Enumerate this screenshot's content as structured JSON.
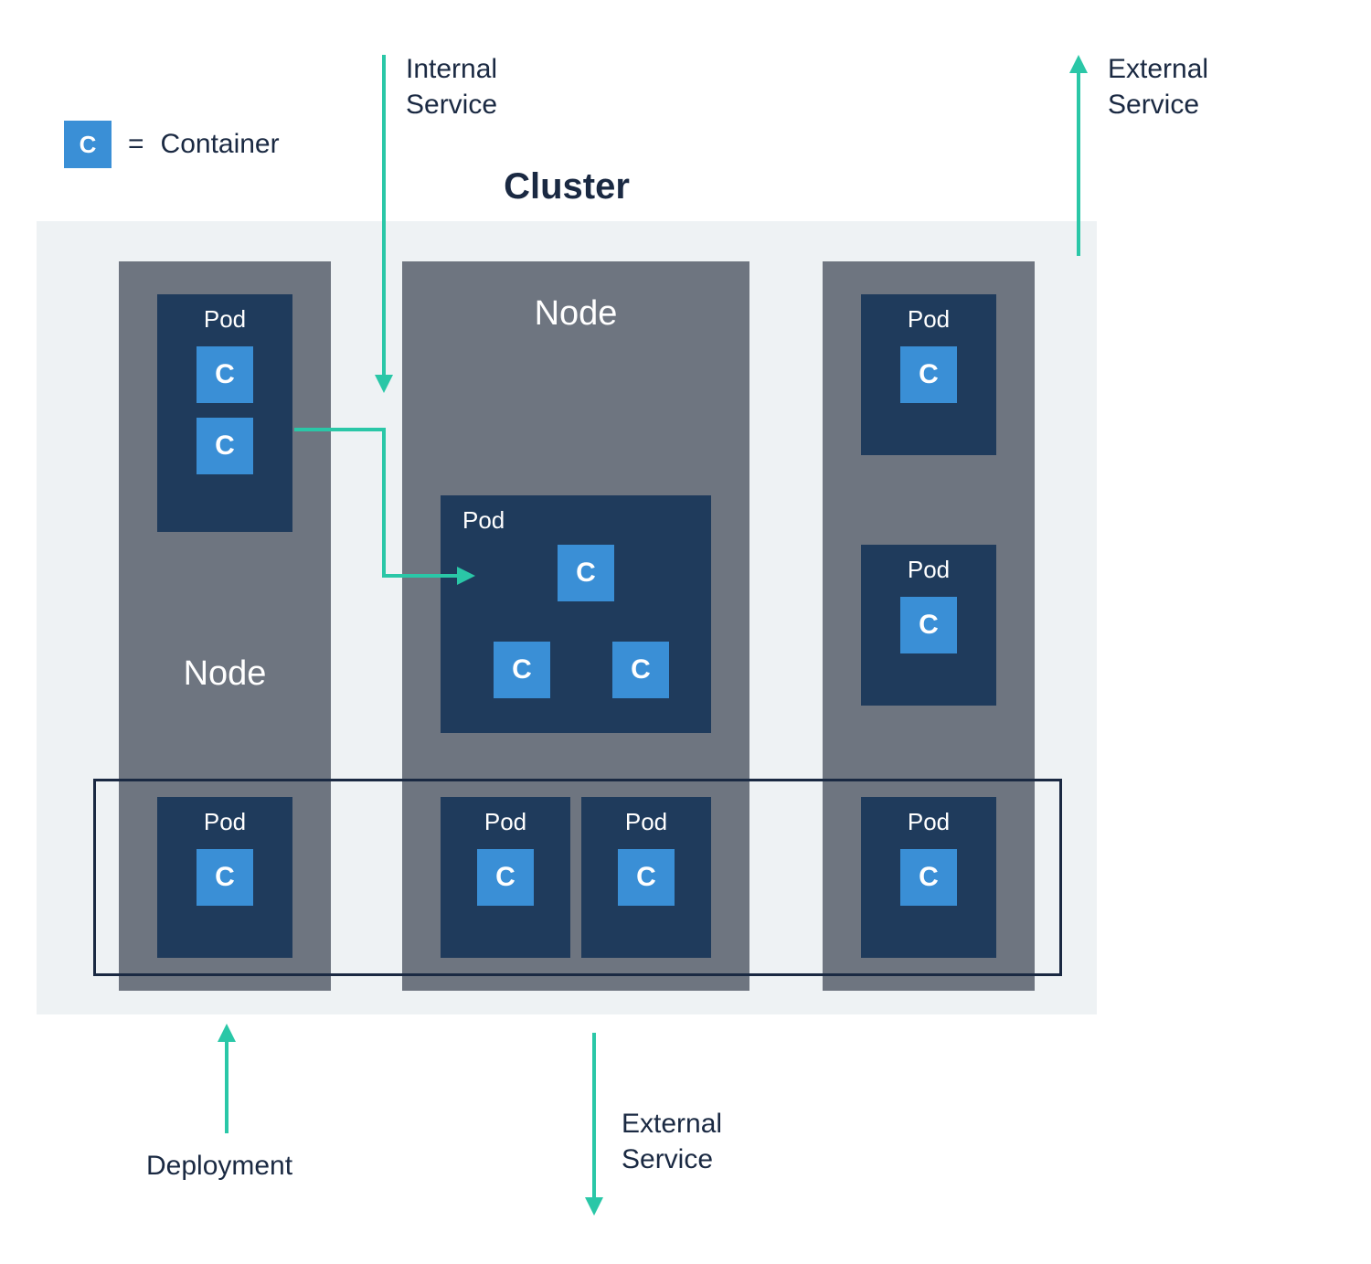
{
  "legend": {
    "box": "C",
    "eq": "=",
    "text": "Container"
  },
  "title": "Cluster",
  "labels": {
    "node": "Node",
    "pod": "Pod",
    "container": "C",
    "internal_service": "Internal\nService",
    "external_service_top": "External\nService",
    "external_service_bottom": "External\nService",
    "deployment": "Deployment"
  },
  "colors": {
    "accent": "#2ac7a7",
    "node_bg": "#6e7580",
    "pod_bg": "#1f3b5c",
    "container_bg": "#3a8fd6",
    "cluster_bg": "#eef2f4",
    "text": "#1a2942"
  },
  "structure": {
    "nodes": [
      {
        "id": "node1",
        "pods": [
          {
            "containers": 2
          },
          {
            "containers": 1
          }
        ]
      },
      {
        "id": "node2",
        "pods": [
          {
            "containers": 3
          },
          {
            "containers": 1
          },
          {
            "containers": 1
          }
        ]
      },
      {
        "id": "node3",
        "pods": [
          {
            "containers": 1
          },
          {
            "containers": 1
          },
          {
            "containers": 1
          }
        ]
      }
    ],
    "deployment_spans_bottom_row": true
  }
}
